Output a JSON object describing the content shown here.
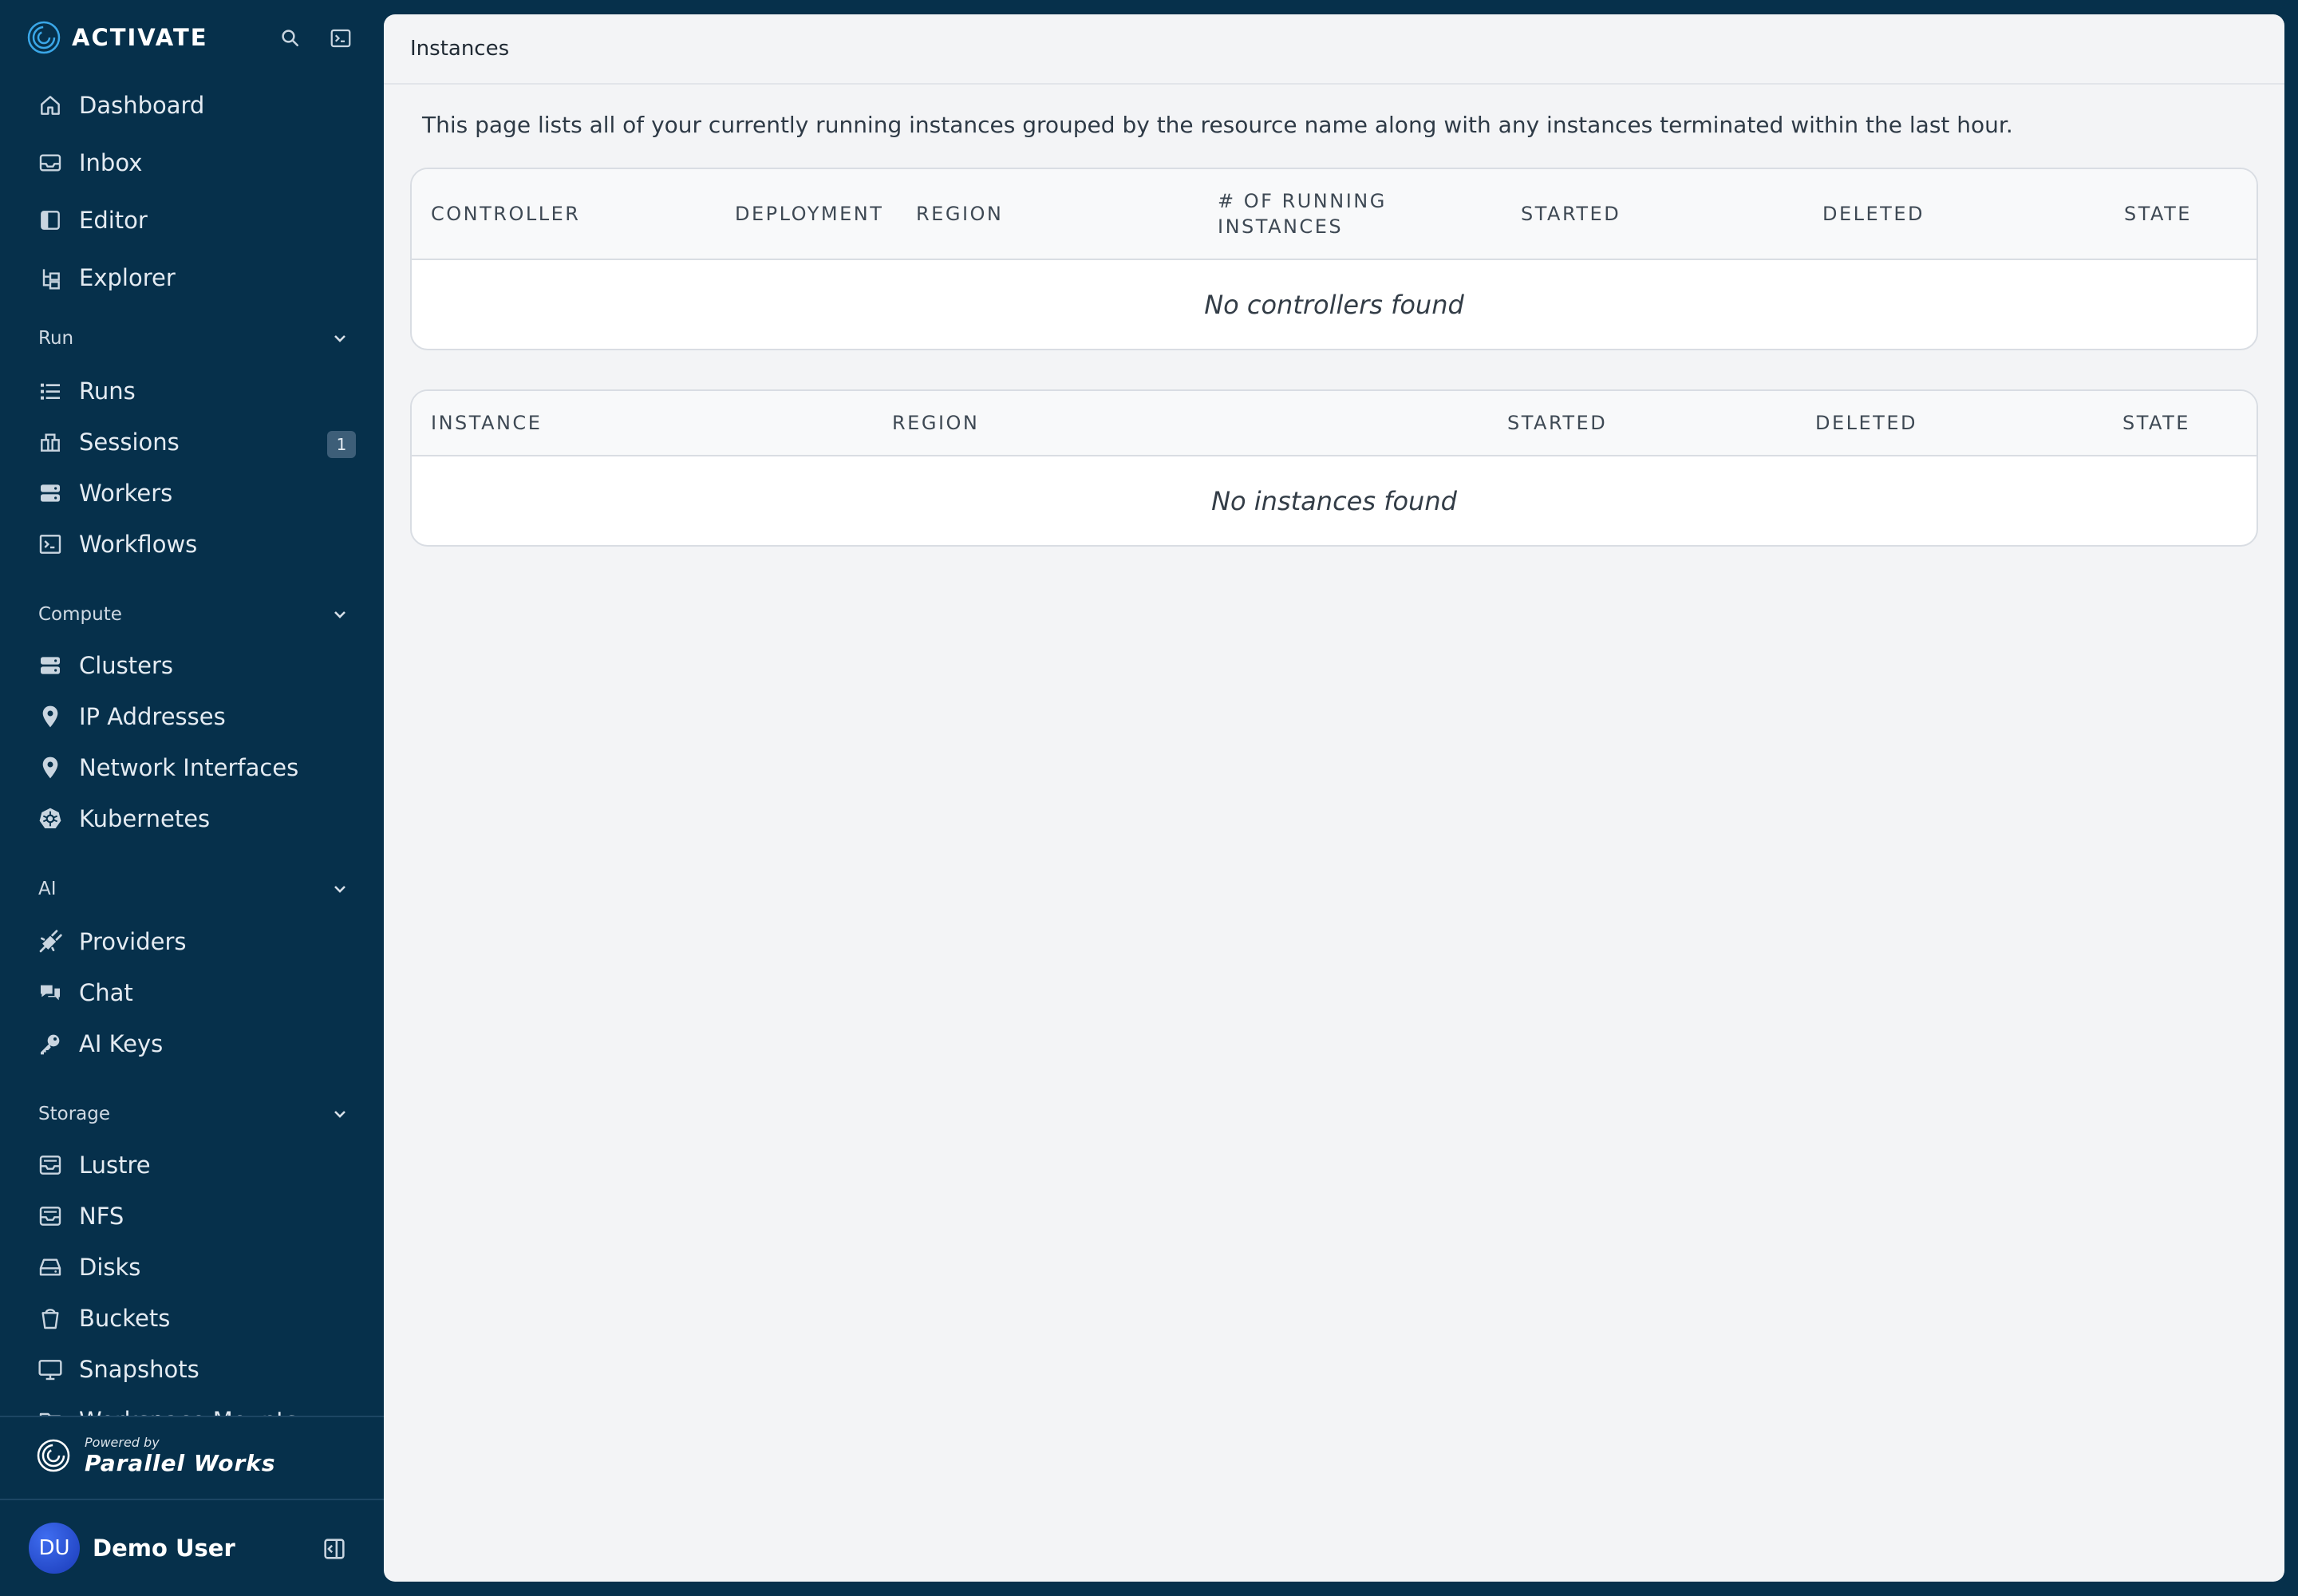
{
  "brand": {
    "name": "ACTIVATE"
  },
  "nav": {
    "primary": [
      {
        "label": "Dashboard"
      },
      {
        "label": "Inbox"
      },
      {
        "label": "Editor"
      },
      {
        "label": "Explorer"
      }
    ],
    "sections": {
      "run": {
        "label": "Run",
        "items": [
          {
            "label": "Runs"
          },
          {
            "label": "Sessions",
            "badge": "1"
          },
          {
            "label": "Workers"
          },
          {
            "label": "Workflows"
          }
        ]
      },
      "compute": {
        "label": "Compute",
        "items": [
          {
            "label": "Clusters"
          },
          {
            "label": "IP Addresses"
          },
          {
            "label": "Network Interfaces"
          },
          {
            "label": "Kubernetes"
          }
        ]
      },
      "ai": {
        "label": "AI",
        "items": [
          {
            "label": "Providers"
          },
          {
            "label": "Chat"
          },
          {
            "label": "AI Keys"
          }
        ]
      },
      "storage": {
        "label": "Storage",
        "items": [
          {
            "label": "Lustre"
          },
          {
            "label": "NFS"
          },
          {
            "label": "Disks"
          },
          {
            "label": "Buckets"
          },
          {
            "label": "Snapshots"
          },
          {
            "label": "Workspace Mounts"
          }
        ]
      }
    }
  },
  "footer": {
    "powered_by": "Powered by",
    "company": "Parallel Works",
    "user_initials": "DU",
    "user_name": "Demo User"
  },
  "page": {
    "title": "Instances",
    "description": "This page lists all of your currently running instances grouped by the resource name along with any instances terminated within the last hour.",
    "controllers_table": {
      "columns": [
        "CONTROLLER",
        "DEPLOYMENT",
        "REGION",
        "# OF RUNNING INSTANCES",
        "STARTED",
        "DELETED",
        "STATE"
      ],
      "empty_text": "No controllers found"
    },
    "instances_table": {
      "columns": [
        "INSTANCE",
        "REGION",
        "STARTED",
        "DELETED",
        "STATE"
      ],
      "empty_text": "No instances found"
    }
  },
  "colors": {
    "sidebar_bg": "#06304b",
    "main_bg": "#f3f4f6",
    "card_bg": "#ffffff",
    "avatar": "#2a4fd6"
  }
}
